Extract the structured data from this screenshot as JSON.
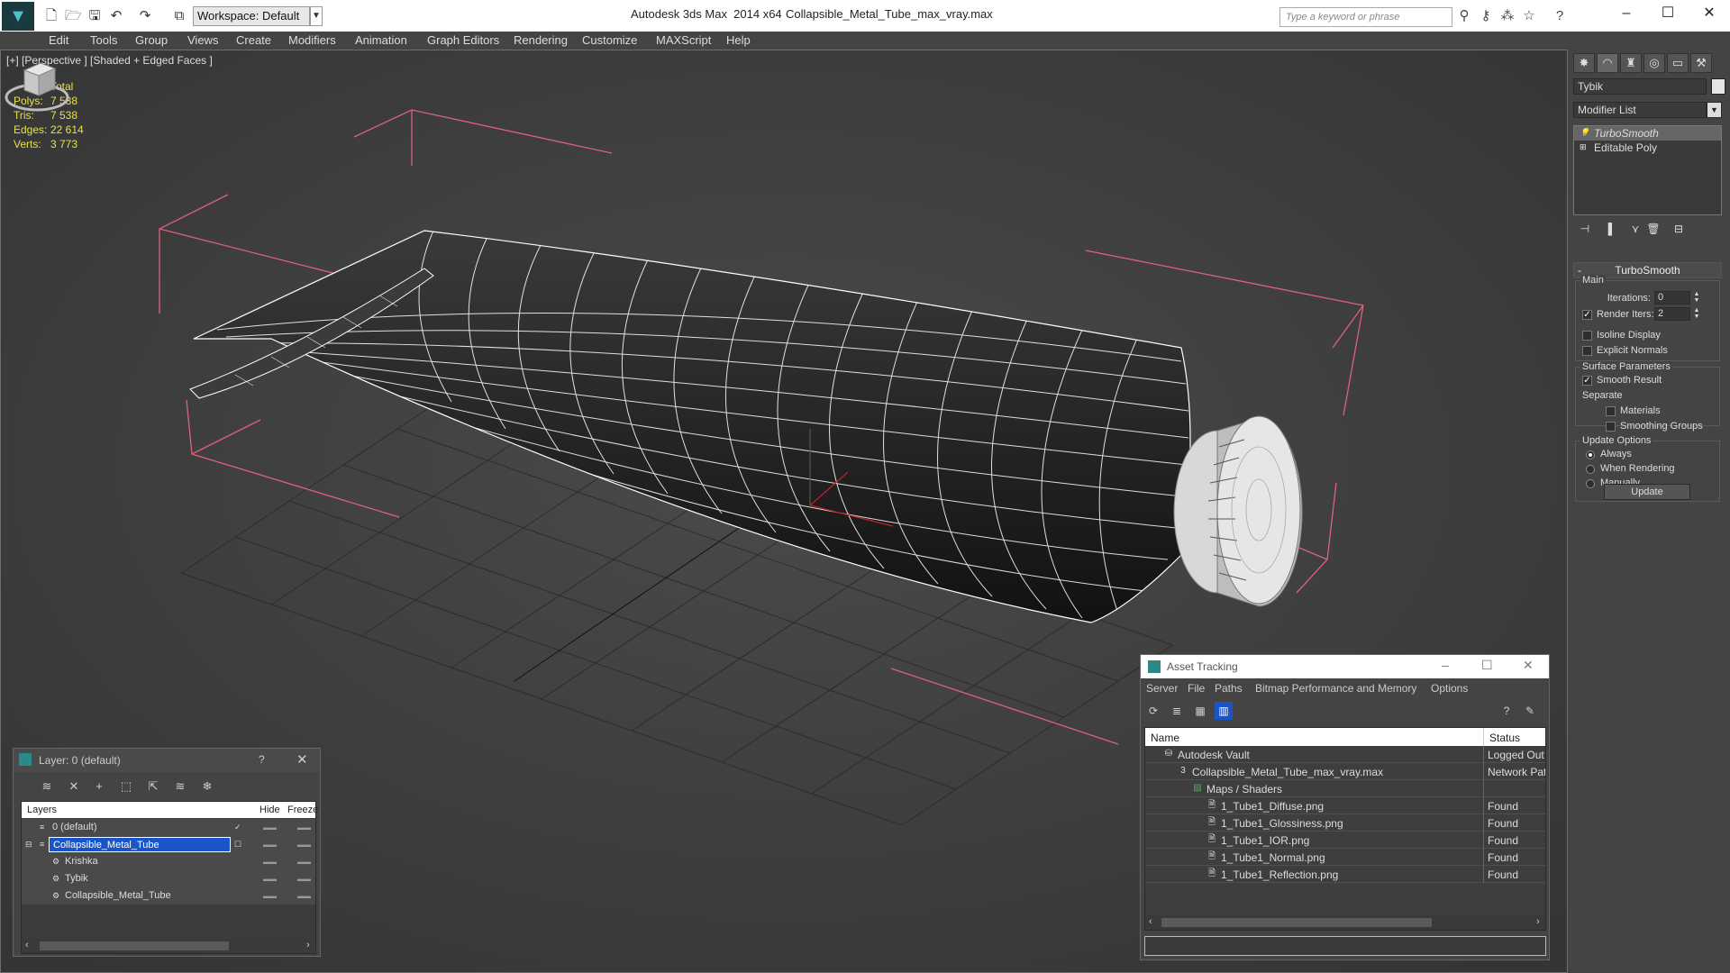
{
  "titlebar": {
    "app_title": "Autodesk 3ds Max  2014 x64",
    "file_title": "Collapsible_Metal_Tube_max_vray.max",
    "workspace": "Workspace: Default",
    "search_placeholder": "Type a keyword or phrase"
  },
  "menu": [
    "Edit",
    "Tools",
    "Group",
    "Views",
    "Create",
    "Modifiers",
    "Animation",
    "Graph Editors",
    "Rendering",
    "Customize",
    "MAXScript",
    "Help"
  ],
  "viewport": {
    "label": "[+] [Perspective ] [Shaded + Edged Faces ]",
    "stats": {
      "header": "Total",
      "rows": [
        {
          "label": "Polys:",
          "value": "7 538"
        },
        {
          "label": "Tris:",
          "value": "7 538"
        },
        {
          "label": "Edges:",
          "value": "22 614"
        },
        {
          "label": "Verts:",
          "value": "3 773"
        }
      ]
    },
    "colors": {
      "stats": "#e8e14e",
      "selection_bracket": "#e0607a",
      "wire": "#ffffff"
    }
  },
  "command_panel": {
    "object_name": "Tybik",
    "modifier_list": "Modifier List",
    "stack": [
      "TurboSmooth",
      "Editable Poly"
    ],
    "turbosmooth": {
      "title": "TurboSmooth",
      "main_label": "Main",
      "iterations_label": "Iterations:",
      "iterations_value": "0",
      "render_iters_label": "Render Iters:",
      "render_iters_value": "2",
      "render_iters_checked": true,
      "isoline_label": "Isoline Display",
      "explicit_label": "Explicit Normals",
      "surface_label": "Surface Parameters",
      "smooth_result_label": "Smooth Result",
      "separate_label": "Separate",
      "materials_label": "Materials",
      "smoothing_groups_label": "Smoothing Groups",
      "update_options_label": "Update Options",
      "always_label": "Always",
      "when_rendering_label": "When Rendering",
      "manually_label": "Manually",
      "update_button": "Update"
    }
  },
  "layer_panel": {
    "title": "Layer: 0 (default)",
    "help": "?",
    "columns": {
      "layers": "Layers",
      "hide": "Hide",
      "freeze": "Freeze"
    },
    "rows": [
      {
        "name": "0 (default)"
      },
      {
        "name": "Collapsible_Metal_Tube"
      },
      {
        "name": "Krishka"
      },
      {
        "name": "Tybik"
      },
      {
        "name": "Collapsible_Metal_Tube"
      }
    ]
  },
  "asset_tracking": {
    "title": "Asset Tracking",
    "menu": [
      "Server",
      "File",
      "Paths",
      "Bitmap Performance and Memory",
      "Options"
    ],
    "columns": {
      "name": "Name",
      "status": "Status"
    },
    "rows": [
      {
        "name": "Autodesk Vault",
        "status": "Logged Out"
      },
      {
        "name": "Collapsible_Metal_Tube_max_vray.max",
        "status": "Network Pat"
      },
      {
        "name": "Maps / Shaders",
        "status": ""
      },
      {
        "name": "1_Tube1_Diffuse.png",
        "status": "Found"
      },
      {
        "name": "1_Tube1_Glossiness.png",
        "status": "Found"
      },
      {
        "name": "1_Tube1_IOR.png",
        "status": "Found"
      },
      {
        "name": "1_Tube1_Normal.png",
        "status": "Found"
      },
      {
        "name": "1_Tube1_Reflection.png",
        "status": "Found"
      }
    ]
  }
}
